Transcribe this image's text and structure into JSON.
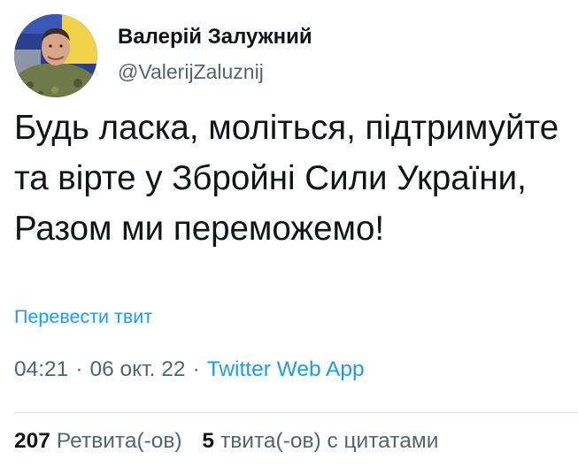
{
  "author": {
    "name": "Валерій Залужний",
    "handle": "@ValerijZaluznij"
  },
  "tweet": {
    "text": "Будь ласка, моліться, підтримуйте та вірте у Збройні Сили України, Разом ми переможемо!",
    "translate_label": "Перевести твит",
    "time": "04:21",
    "separator": "·",
    "date": "06 окт. 22",
    "source": "Twitter Web App"
  },
  "stats": {
    "retweets_count": "207",
    "retweets_label": "Ретвита(-ов)",
    "quotes_count": "5",
    "quotes_label": "твита(-ов) с цитатами"
  },
  "colors": {
    "text": "#0f1419",
    "secondary": "#536471",
    "link": "#1d9bf0",
    "divider": "#e6e9eb"
  },
  "icons": {
    "avatar": "profile-photo"
  }
}
